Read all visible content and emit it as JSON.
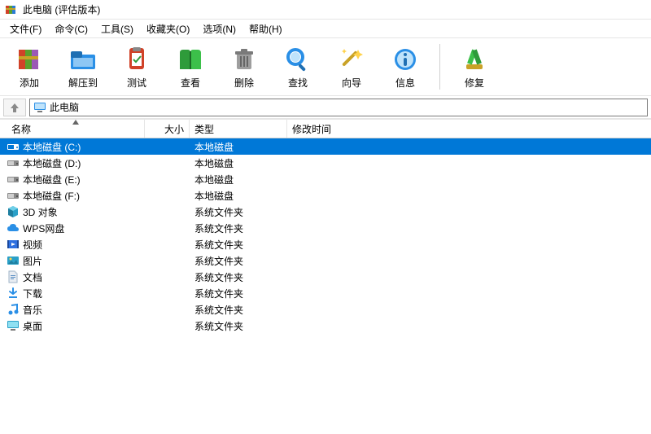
{
  "window": {
    "title": "此电脑 (评估版本)"
  },
  "menu": [
    {
      "label": "文件(F)"
    },
    {
      "label": "命令(C)"
    },
    {
      "label": "工具(S)"
    },
    {
      "label": "收藏夹(O)"
    },
    {
      "label": "选项(N)"
    },
    {
      "label": "帮助(H)"
    }
  ],
  "toolbar": [
    {
      "label": "添加",
      "icon": "archive-add"
    },
    {
      "label": "解压到",
      "icon": "folder-extract"
    },
    {
      "label": "测试",
      "icon": "test"
    },
    {
      "label": "查看",
      "icon": "view"
    },
    {
      "label": "删除",
      "icon": "trash"
    },
    {
      "label": "查找",
      "icon": "search"
    },
    {
      "label": "向导",
      "icon": "wand"
    },
    {
      "label": "信息",
      "icon": "info"
    },
    {
      "label": "修复",
      "icon": "repair"
    }
  ],
  "address": {
    "path": "此电脑"
  },
  "columns": {
    "name": "名称",
    "size": "大小",
    "type": "类型",
    "date": "修改时间"
  },
  "rows": [
    {
      "name": "本地磁盘 (C:)",
      "type": "本地磁盘",
      "icon": "drive-blue",
      "selected": true
    },
    {
      "name": "本地磁盘 (D:)",
      "type": "本地磁盘",
      "icon": "drive"
    },
    {
      "name": "本地磁盘 (E:)",
      "type": "本地磁盘",
      "icon": "drive"
    },
    {
      "name": "本地磁盘 (F:)",
      "type": "本地磁盘",
      "icon": "drive"
    },
    {
      "name": "3D 对象",
      "type": "系统文件夹",
      "icon": "box3d"
    },
    {
      "name": "WPS网盘",
      "type": "系统文件夹",
      "icon": "cloud"
    },
    {
      "name": "视频",
      "type": "系统文件夹",
      "icon": "video"
    },
    {
      "name": "图片",
      "type": "系统文件夹",
      "icon": "picture"
    },
    {
      "name": "文档",
      "type": "系统文件夹",
      "icon": "document"
    },
    {
      "name": "下载",
      "type": "系统文件夹",
      "icon": "download"
    },
    {
      "name": "音乐",
      "type": "系统文件夹",
      "icon": "music"
    },
    {
      "name": "桌面",
      "type": "系统文件夹",
      "icon": "desktop"
    }
  ]
}
